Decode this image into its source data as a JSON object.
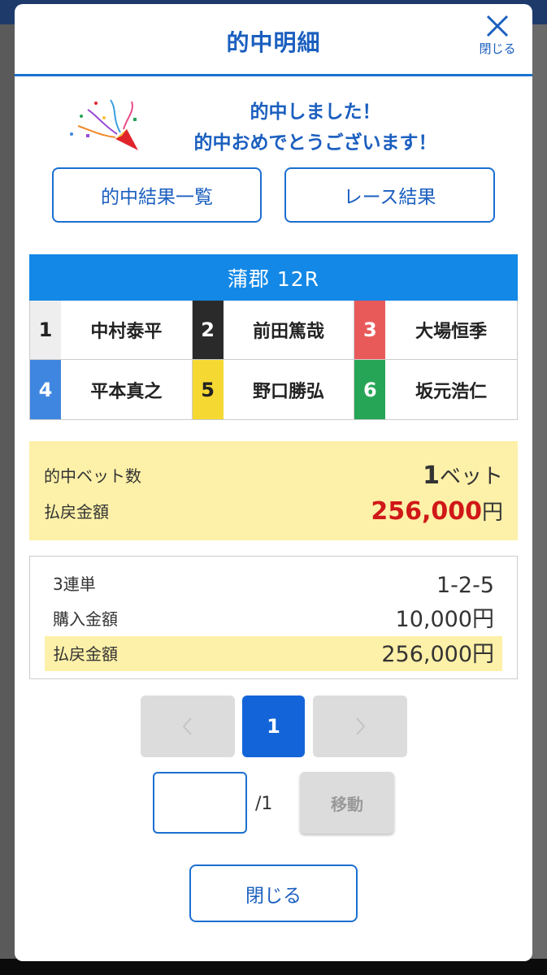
{
  "modal": {
    "title": "的中明細",
    "close_label": "閉じる"
  },
  "congrats": {
    "line1": "的中しました！",
    "line2": "的中おめでとうございます！"
  },
  "buttons": {
    "hit_results_list": "的中結果一覧",
    "race_results": "レース結果"
  },
  "race": {
    "title": "蒲郡 12R",
    "racers": [
      {
        "num": "1",
        "name": "中村泰平",
        "bg": "#eeeeee",
        "fg": "#222222"
      },
      {
        "num": "2",
        "name": "前田篤哉",
        "bg": "#2a2a2a",
        "fg": "#ffffff"
      },
      {
        "num": "3",
        "name": "大場恒季",
        "bg": "#e85a5a",
        "fg": "#ffffff"
      },
      {
        "num": "4",
        "name": "平本真之",
        "bg": "#3f86e0",
        "fg": "#ffffff"
      },
      {
        "num": "5",
        "name": "野口勝弘",
        "bg": "#f5d932",
        "fg": "#222222"
      },
      {
        "num": "6",
        "name": "坂元浩仁",
        "bg": "#27a556",
        "fg": "#ffffff"
      }
    ]
  },
  "summary": {
    "hit_bets_label": "的中ベット数",
    "hit_bets_value": "1",
    "hit_bets_unit": "ベット",
    "payout_label": "払戻金額",
    "payout_value": "256,000",
    "payout_unit": "円"
  },
  "detail": {
    "bet_type": "3連単",
    "combination": "1-2-5",
    "purchase_label": "購入金額",
    "purchase_value": "10,000円",
    "payout_label": "払戻金額",
    "payout_value": "256,000円"
  },
  "pagination": {
    "current_page": "1",
    "prev_icon": "chevron-left-icon",
    "next_icon": "chevron-right-icon",
    "total": "/1",
    "move_label": "移動"
  },
  "footer": {
    "close_label": "閉じる"
  },
  "colors": {
    "accent": "#1b6fd0",
    "race_header": "#1388e6",
    "highlight": "#fdf0a8",
    "payout_red": "#d01818",
    "current_page": "#1364d8"
  }
}
